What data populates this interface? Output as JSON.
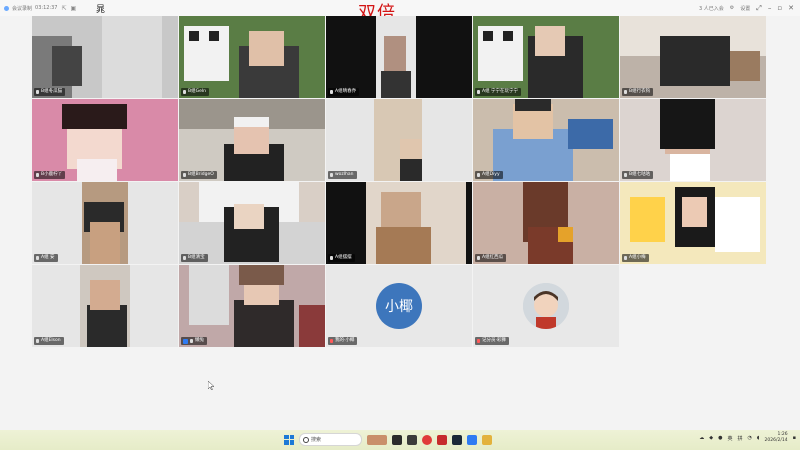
{
  "window": {
    "title": "会议录制",
    "elapsed": "03:12:37",
    "logo_char": "晁",
    "right_status": "3 人已入会",
    "settings_label": "设置"
  },
  "overlay_title": "双倍",
  "participants": [
    {
      "label": "B组冬瓜猫",
      "type": "video",
      "muted": false
    },
    {
      "label": "B组Geln",
      "type": "video",
      "muted": false
    },
    {
      "label": "A组晴春乔",
      "type": "video",
      "muted": false
    },
    {
      "label": "A组 宁宁在玩宁宁",
      "type": "video",
      "muted": false
    },
    {
      "label": "B组行衣钩",
      "type": "video",
      "muted": false
    },
    {
      "label": "B小鹿柠丫",
      "type": "video",
      "muted": false
    },
    {
      "label": "B组BridgeO",
      "type": "video",
      "muted": false
    },
    {
      "label": "wozlhan",
      "type": "video",
      "muted": false
    },
    {
      "label": "A组Diyy",
      "type": "video",
      "muted": false
    },
    {
      "label": "B组七咕咕",
      "type": "video",
      "muted": false
    },
    {
      "label": "A组 安",
      "type": "video",
      "muted": false
    },
    {
      "label": "B组清宝",
      "type": "video",
      "muted": false
    },
    {
      "label": "A组摆摆",
      "type": "video",
      "muted": false
    },
    {
      "label": "A组红西瓜",
      "type": "video",
      "muted": false
    },
    {
      "label": "A组小梅",
      "type": "video",
      "muted": false
    },
    {
      "label": "A组Elson",
      "type": "video",
      "muted": false
    },
    {
      "label": "懒兔",
      "type": "video",
      "muted": false,
      "host": true
    },
    {
      "label": "我的·小椰",
      "type": "initials",
      "initials": "小椰",
      "muted": true
    },
    {
      "label": "记分员·彩狮",
      "type": "photo",
      "muted": true
    }
  ],
  "taskbar": {
    "search_placeholder": "搜索",
    "tray_lang": "英",
    "tray_ime": "拼",
    "time": "1:26",
    "date": "2026/2/14"
  },
  "colors": {
    "overlay_red": "#d31414",
    "avatar_blue": "#3d76bc",
    "host_blue": "#2f7bf2"
  }
}
